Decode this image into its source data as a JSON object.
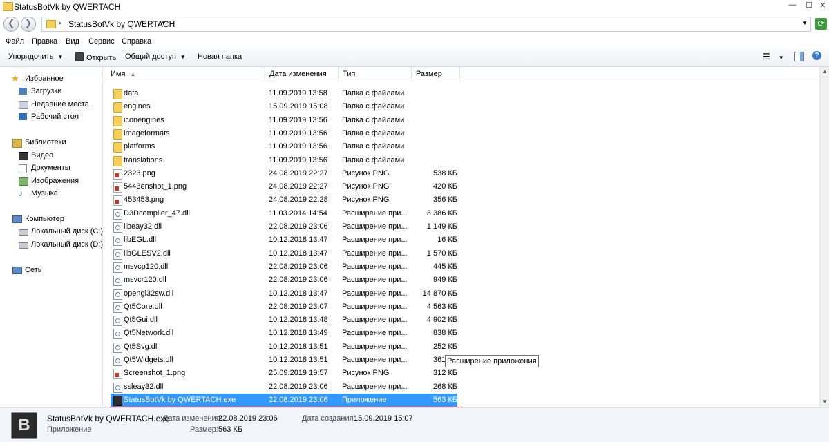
{
  "window": {
    "title": "StatusBotVk by QWERTACH"
  },
  "address": {
    "path": "StatusBotVk by QWERTACH"
  },
  "menu": [
    "Файл",
    "Правка",
    "Вид",
    "Сервис",
    "Справка"
  ],
  "toolbar": {
    "organize": "Упорядочить",
    "open": "Открыть",
    "share": "Общий доступ",
    "new_folder": "Новая папка"
  },
  "sidebar": {
    "favorites": "Избранное",
    "favorites_items": [
      "Загрузки",
      "Недавние места",
      "Рабочий стол"
    ],
    "libraries": "Библиотеки",
    "libraries_items": [
      "Видео",
      "Документы",
      "Изображения",
      "Музыка"
    ],
    "computer": "Компьютер",
    "computer_items": [
      "Локальный диск (C:)",
      "Локальный диск (D:)"
    ],
    "network": "Сеть"
  },
  "columns": {
    "name": "Имя",
    "date": "Дата изменения",
    "type": "Тип",
    "size": "Размер"
  },
  "files": [
    {
      "name": "data",
      "date": "11.09.2019 13:58",
      "type": "Папка с файлами",
      "size": "",
      "kind": "folder"
    },
    {
      "name": "engines",
      "date": "15.09.2019 15:08",
      "type": "Папка с файлами",
      "size": "",
      "kind": "folder"
    },
    {
      "name": "iconengines",
      "date": "11.09.2019 13:56",
      "type": "Папка с файлами",
      "size": "",
      "kind": "folder"
    },
    {
      "name": "imageformats",
      "date": "11.09.2019 13:56",
      "type": "Папка с файлами",
      "size": "",
      "kind": "folder"
    },
    {
      "name": "platforms",
      "date": "11.09.2019 13:56",
      "type": "Папка с файлами",
      "size": "",
      "kind": "folder"
    },
    {
      "name": "translations",
      "date": "11.09.2019 13:56",
      "type": "Папка с файлами",
      "size": "",
      "kind": "folder"
    },
    {
      "name": "2323.png",
      "date": "24.08.2019 22:27",
      "type": "Рисунок PNG",
      "size": "538 КБ",
      "kind": "png"
    },
    {
      "name": "5443enshot_1.png",
      "date": "24.08.2019 22:27",
      "type": "Рисунок PNG",
      "size": "420 КБ",
      "kind": "png"
    },
    {
      "name": "453453.png",
      "date": "24.08.2019 22:28",
      "type": "Рисунок PNG",
      "size": "356 КБ",
      "kind": "png"
    },
    {
      "name": "D3Dcompiler_47.dll",
      "date": "11.03.2014 14:54",
      "type": "Расширение при...",
      "size": "3 386 КБ",
      "kind": "dll"
    },
    {
      "name": "libeay32.dll",
      "date": "22.08.2019 23:06",
      "type": "Расширение при...",
      "size": "1 149 КБ",
      "kind": "dll"
    },
    {
      "name": "libEGL.dll",
      "date": "10.12.2018 13:47",
      "type": "Расширение при...",
      "size": "16 КБ",
      "kind": "dll"
    },
    {
      "name": "libGLESV2.dll",
      "date": "10.12.2018 13:47",
      "type": "Расширение при...",
      "size": "1 570 КБ",
      "kind": "dll"
    },
    {
      "name": "msvcp120.dll",
      "date": "22.08.2019 23:06",
      "type": "Расширение при...",
      "size": "445 КБ",
      "kind": "dll"
    },
    {
      "name": "msvcr120.dll",
      "date": "22.08.2019 23:06",
      "type": "Расширение при...",
      "size": "949 КБ",
      "kind": "dll"
    },
    {
      "name": "opengl32sw.dll",
      "date": "10.12.2018 13:47",
      "type": "Расширение при...",
      "size": "14 870 КБ",
      "kind": "dll"
    },
    {
      "name": "Qt5Core.dll",
      "date": "22.08.2019 23:07",
      "type": "Расширение при...",
      "size": "4 563 КБ",
      "kind": "dll"
    },
    {
      "name": "Qt5Gui.dll",
      "date": "10.12.2018 13:48",
      "type": "Расширение при...",
      "size": "4 902 КБ",
      "kind": "dll"
    },
    {
      "name": "Qt5Network.dll",
      "date": "10.12.2018 13:49",
      "type": "Расширение при...",
      "size": "838 КБ",
      "kind": "dll"
    },
    {
      "name": "Qt5Svg.dll",
      "date": "10.12.2018 13:51",
      "type": "Расширение при...",
      "size": "252 КБ",
      "kind": "dll"
    },
    {
      "name": "Qt5Widgets.dll",
      "date": "10.12.2018 13:51",
      "type": "Расширение при...",
      "size": "361 КБ",
      "kind": "dll"
    },
    {
      "name": "Screenshot_1.png",
      "date": "25.09.2019 19:57",
      "type": "Рисунок PNG",
      "size": "312 КБ",
      "kind": "png"
    },
    {
      "name": "ssleay32.dll",
      "date": "22.08.2019 23:06",
      "type": "Расширение при...",
      "size": "268 КБ",
      "kind": "dll"
    },
    {
      "name": "StatusBotVk by QWERTACH.exe",
      "date": "22.08.2019 23:06",
      "type": "Приложение",
      "size": "563 КБ",
      "kind": "exe",
      "selected": true
    }
  ],
  "tooltip": "Расширение приложения",
  "details": {
    "filename": "StatusBotVk by QWERTACH.exe",
    "kind": "Приложение",
    "modified_label": "Дата изменения:",
    "modified": "22.08.2019 23:06",
    "created_label": "Дата создания:",
    "created": "15.09.2019 15:07",
    "size_label": "Размер:",
    "size": "563 КБ"
  },
  "colors": {
    "selection": "#3399ff",
    "underline": "#d81c1c"
  }
}
